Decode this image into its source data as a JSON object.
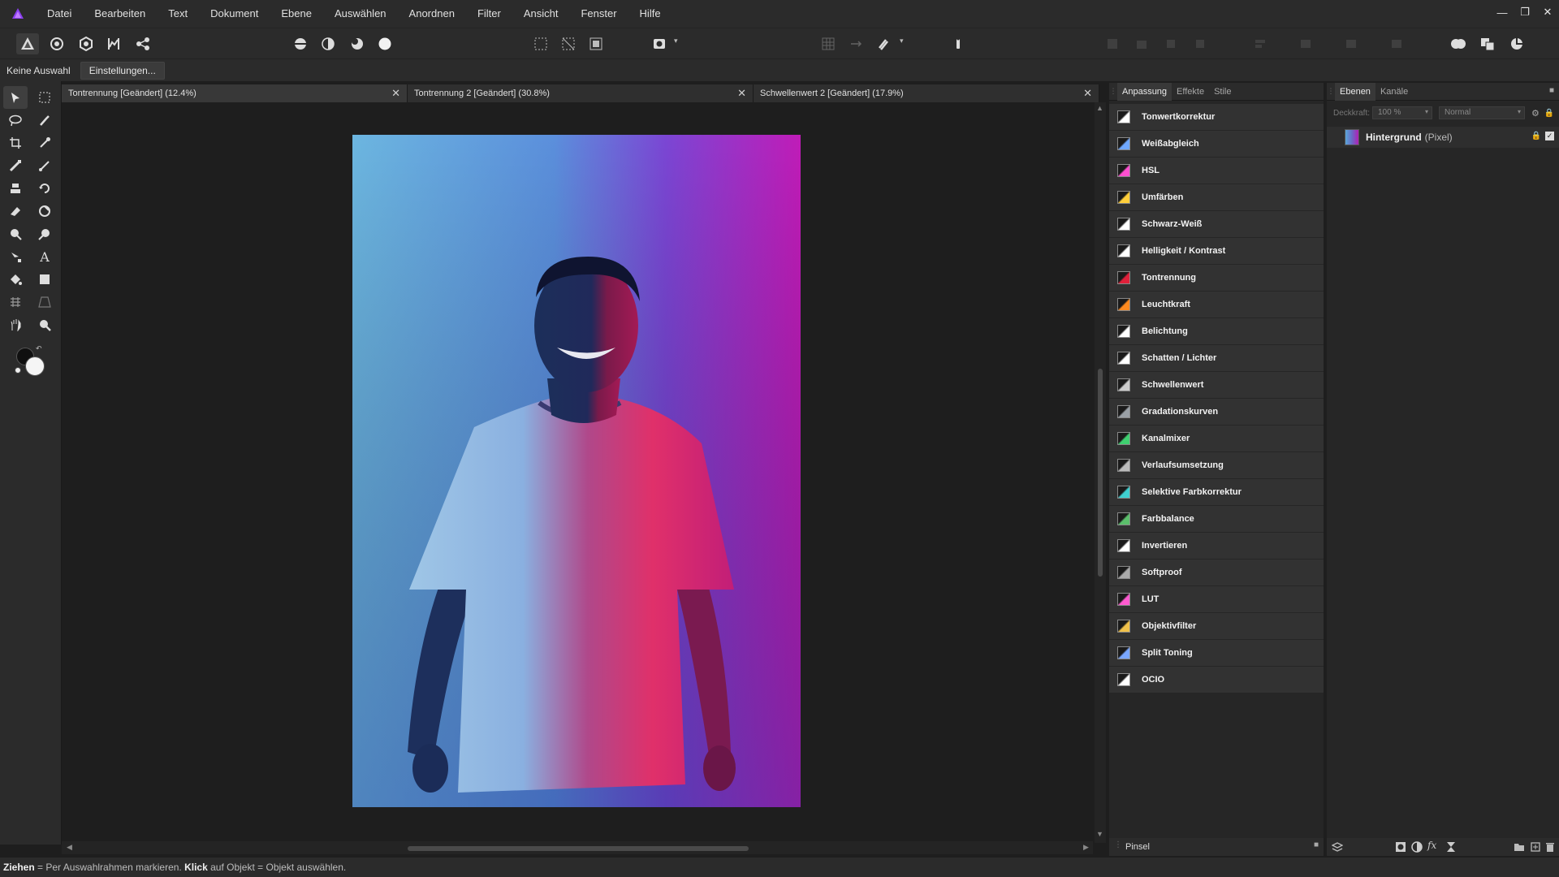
{
  "menu": [
    "Datei",
    "Bearbeiten",
    "Text",
    "Dokument",
    "Ebene",
    "Auswählen",
    "Anordnen",
    "Filter",
    "Ansicht",
    "Fenster",
    "Hilfe"
  ],
  "context": {
    "selection": "Keine Auswahl",
    "settings": "Einstellungen..."
  },
  "tabs": [
    {
      "label": "Tontrennung [Geändert] (12.4%)"
    },
    {
      "label": "Tontrennung 2 [Geändert] (30.8%)"
    },
    {
      "label": "Schwellenwert 2 [Geändert] (17.9%)"
    }
  ],
  "adjustment_panel": {
    "tabs": [
      "Anpassung",
      "Effekte",
      "Stile"
    ],
    "items": [
      {
        "label": "Tonwertkorrektur",
        "icon": "levels-icon",
        "color": "#ffffff"
      },
      {
        "label": "Weißabgleich",
        "icon": "white-balance-icon",
        "color": "#6fa8ff"
      },
      {
        "label": "HSL",
        "icon": "hsl-icon",
        "color": "#ff4fd0"
      },
      {
        "label": "Umfärben",
        "icon": "recolor-icon",
        "color": "#ffcf3a"
      },
      {
        "label": "Schwarz-Weiß",
        "icon": "black-white-icon",
        "color": "#ffffff"
      },
      {
        "label": "Helligkeit / Kontrast",
        "icon": "brightness-contrast-icon",
        "color": "#ffffff"
      },
      {
        "label": "Tontrennung",
        "icon": "posterize-icon",
        "color": "#e0203a"
      },
      {
        "label": "Leuchtkraft",
        "icon": "vibrance-icon",
        "color": "#ff8a1f"
      },
      {
        "label": "Belichtung",
        "icon": "exposure-icon",
        "color": "#ffffff"
      },
      {
        "label": "Schatten / Lichter",
        "icon": "shadows-highlights-icon",
        "color": "#ffffff"
      },
      {
        "label": "Schwellenwert",
        "icon": "threshold-icon",
        "color": "#cccccc"
      },
      {
        "label": "Gradationskurven",
        "icon": "curves-icon",
        "color": "#9aa0a6"
      },
      {
        "label": "Kanalmixer",
        "icon": "channel-mixer-icon",
        "color": "#3fd070"
      },
      {
        "label": "Verlaufsumsetzung",
        "icon": "gradient-map-icon",
        "color": "#bbbbbb"
      },
      {
        "label": "Selektive Farbkorrektur",
        "icon": "selective-color-icon",
        "color": "#3fd0d0"
      },
      {
        "label": "Farbbalance",
        "icon": "color-balance-icon",
        "color": "#5bbf6b"
      },
      {
        "label": "Invertieren",
        "icon": "invert-icon",
        "color": "#ffffff"
      },
      {
        "label": "Softproof",
        "icon": "soft-proof-icon",
        "color": "#aaaaaa"
      },
      {
        "label": "LUT",
        "icon": "lut-icon",
        "color": "#ff5ad0"
      },
      {
        "label": "Objektivfilter",
        "icon": "lens-filter-icon",
        "color": "#f0c14a"
      },
      {
        "label": "Split Toning",
        "icon": "split-toning-icon",
        "color": "#7aa7ff"
      },
      {
        "label": "OCIO",
        "icon": "ocio-icon",
        "color": "#ffffff"
      }
    ]
  },
  "layers_panel": {
    "tabs": [
      "Ebenen",
      "Kanäle"
    ],
    "opacity_label": "Deckkraft:",
    "opacity": "100 %",
    "blend_mode": "Normal",
    "layer": {
      "name": "Hintergrund",
      "type": "(Pixel)"
    }
  },
  "brush_panel": {
    "label": "Pinsel"
  },
  "status": {
    "drag": "Ziehen",
    "drag_desc": " = Per Auswahlrahmen markieren. ",
    "click": "Klick",
    "click_desc": " auf Objekt = Objekt auswählen."
  },
  "colors": {
    "accent": "#8a3ff0",
    "bg": "#1e1e1e",
    "panel": "#2b2b2b"
  }
}
